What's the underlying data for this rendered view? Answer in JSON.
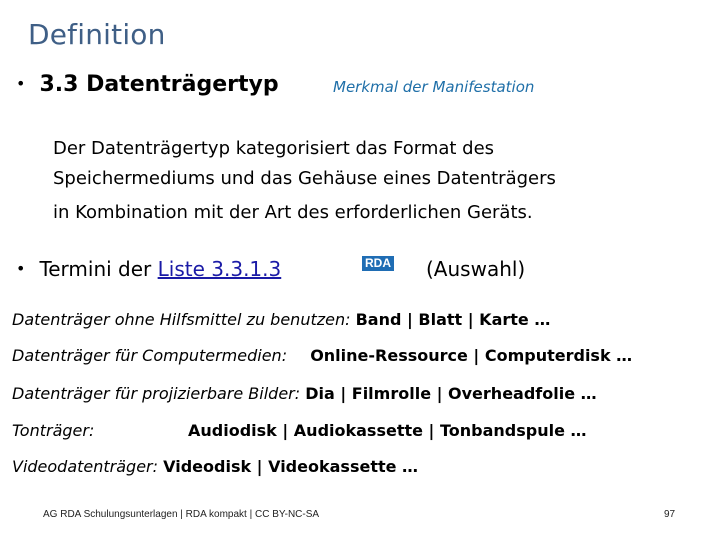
{
  "title": "Definition",
  "section": {
    "bullet": "•",
    "heading": "3.3 Datenträgertyp",
    "annotation": "Merkmal der Manifestation"
  },
  "definition_lines": [
    "Der Datenträgertyp kategorisiert das Format des",
    "Speichermediums und das Gehäuse eines Datenträgers",
    "in Kombination mit der Art des erforderlichen Geräts."
  ],
  "termini": {
    "bullet": "•",
    "prefix": "Termini der ",
    "link_text": "Liste 3.3.1.3",
    "badge": "RDA",
    "suffix": "(Auswahl)"
  },
  "categories": [
    {
      "label": "Datenträger ohne Hilfsmittel zu benutzen:",
      "values": "Band | Blatt | Karte …"
    },
    {
      "label": "Datenträger für Computermedien:",
      "values": "Online-Ressource | Computerdisk …"
    },
    {
      "label": "Datenträger für projizierbare Bilder:",
      "values": "Dia | Filmrolle | Overheadfolie …"
    },
    {
      "label": "Tonträger:",
      "values": "Audiodisk | Audiokassette | Tonbandspule …"
    },
    {
      "label": "Videodatenträger:",
      "values": "Videodisk | Videokassette …"
    }
  ],
  "footer": {
    "text": "AG RDA Schulungsunterlagen | RDA kompakt | CC BY-NC-SA",
    "page_number": "97"
  }
}
